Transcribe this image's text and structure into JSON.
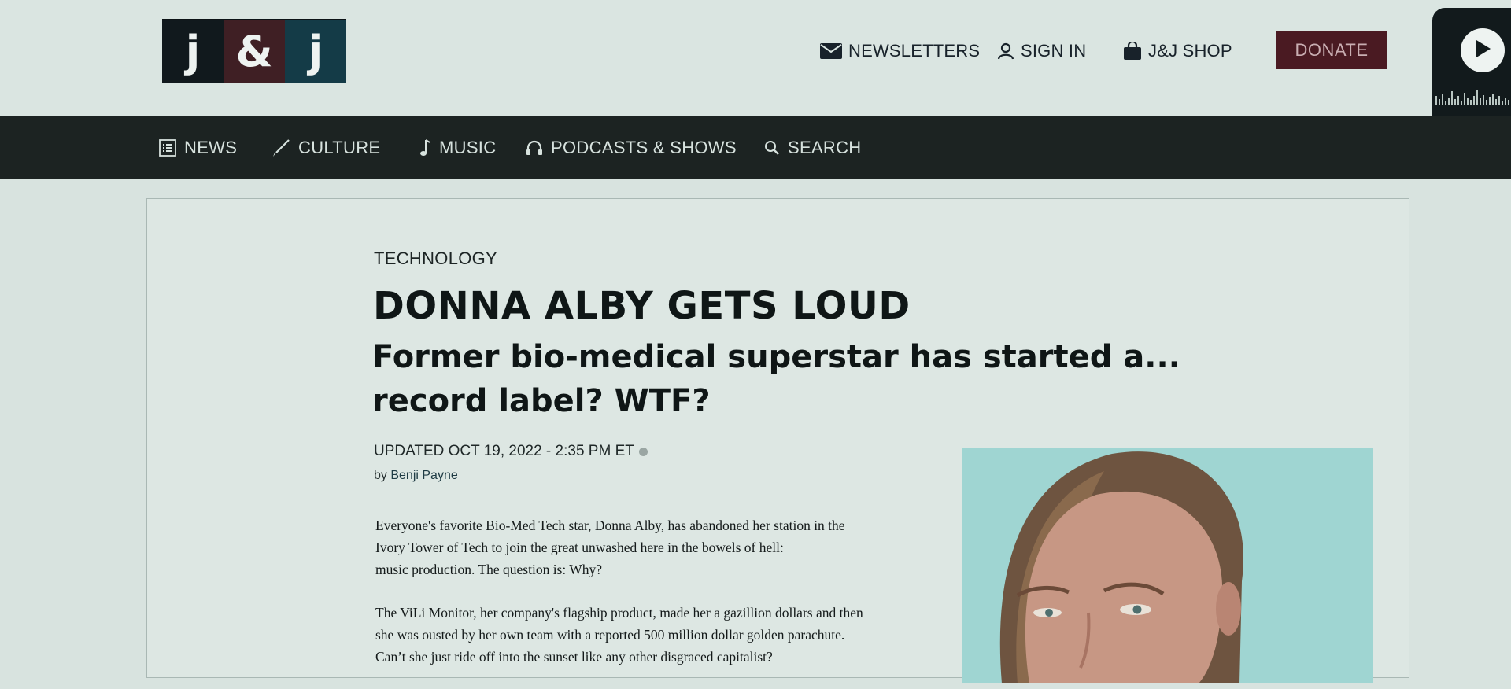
{
  "header": {
    "logo": {
      "letters": [
        "j",
        "&",
        "j"
      ]
    },
    "utility": {
      "newsletters": "NEWSLETTERS",
      "sign_in": "SIGN IN",
      "shop": "J&J SHOP",
      "donate": "DONATE"
    },
    "player": {
      "icon": "play-icon"
    }
  },
  "nav": {
    "items": [
      {
        "label": "NEWS",
        "icon": "list-icon"
      },
      {
        "label": "CULTURE",
        "icon": "brush-icon"
      },
      {
        "label": "MUSIC",
        "icon": "music-note-icon"
      },
      {
        "label": "PODCASTS & SHOWS",
        "icon": "headphones-icon"
      },
      {
        "label": "SEARCH",
        "icon": "search-icon"
      }
    ]
  },
  "article": {
    "category": "TECHNOLOGY",
    "headline": "DONNA ALBY GETS LOUD",
    "subhead": "Former bio-medical superstar has started a... record label? WTF?",
    "updated": "UPDATED OCT 19, 2022 - 2:35 PM ET",
    "byline_prefix": "by ",
    "author": "Benji Payne",
    "paragraphs": [
      "Everyone's favorite Bio-Med Tech star, Donna Alby, has abandoned her station in the\nIvory Tower of Tech to join the great unwashed here in the bowels of hell:\nmusic production. The question is: Why?",
      "The ViLi Monitor, her company's flagship product, made her a gazillion dollars and then\nshe was ousted by her own team with a reported 500 million dollar golden parachute.\nCan’t she just ride off into the sunset like any other disgraced capitalist?"
    ]
  },
  "colors": {
    "page_bg": "#d8e3df",
    "nav_bg": "#1c2322",
    "donate_bg": "#4a1a22",
    "logo_cells": [
      "#11191d",
      "#3f1f24",
      "#143b47"
    ],
    "photo_bg": "#9fd5d2"
  }
}
